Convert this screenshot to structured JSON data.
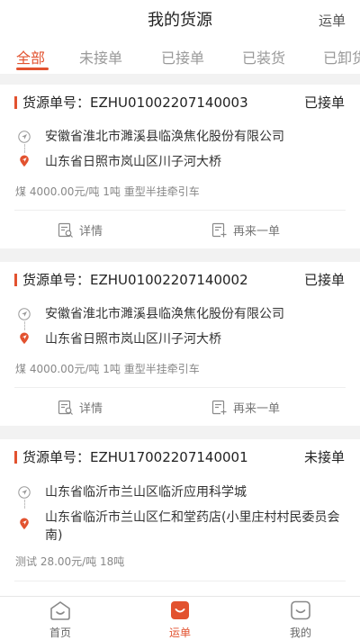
{
  "header": {
    "title": "我的货源",
    "right_link": "运单"
  },
  "tabs": [
    {
      "label": "全部"
    },
    {
      "label": "未接单"
    },
    {
      "label": "已接单"
    },
    {
      "label": "已装货"
    },
    {
      "label": "已卸货"
    }
  ],
  "cards": [
    {
      "order_label": "货源单号：",
      "order_no": "EZHU01002207140003",
      "status": "已接单",
      "from": "安徽省淮北市濉溪县临涣焦化股份有限公司",
      "to": "山东省日照市岚山区川子河大桥",
      "cargo": "煤  4000.00元/吨  1吨  重型半挂牵引车",
      "details_label": "详情",
      "reorder_label": "再来一单"
    },
    {
      "order_label": "货源单号：",
      "order_no": "EZHU01002207140002",
      "status": "已接单",
      "from": "安徽省淮北市濉溪县临涣焦化股份有限公司",
      "to": "山东省日照市岚山区川子河大桥",
      "cargo": "煤  4000.00元/吨  1吨  重型半挂牵引车",
      "details_label": "详情",
      "reorder_label": "再来一单"
    },
    {
      "order_label": "货源单号：",
      "order_no": "EZHU17002207140001",
      "status": "未接单",
      "from": "山东省临沂市兰山区临沂应用科学城",
      "to": "山东省临沂市兰山区仁和堂药店(小里庄村村民委员会南)",
      "cargo": "测试  28.00元/吨  18吨"
    }
  ],
  "bottom_nav": [
    {
      "label": "首页"
    },
    {
      "label": "运单"
    },
    {
      "label": "我的"
    }
  ],
  "colors": {
    "accent": "#e2522f",
    "text": "#333333",
    "muted": "#888888",
    "background": "#f2f2f2"
  },
  "icons": {
    "origin": "navigation-arrow-icon",
    "destination": "location-pin-icon",
    "details": "document-search-icon",
    "reorder": "document-add-icon",
    "home": "home-smile-icon",
    "waybill": "waybill-smile-icon",
    "profile": "profile-smile-icon"
  }
}
